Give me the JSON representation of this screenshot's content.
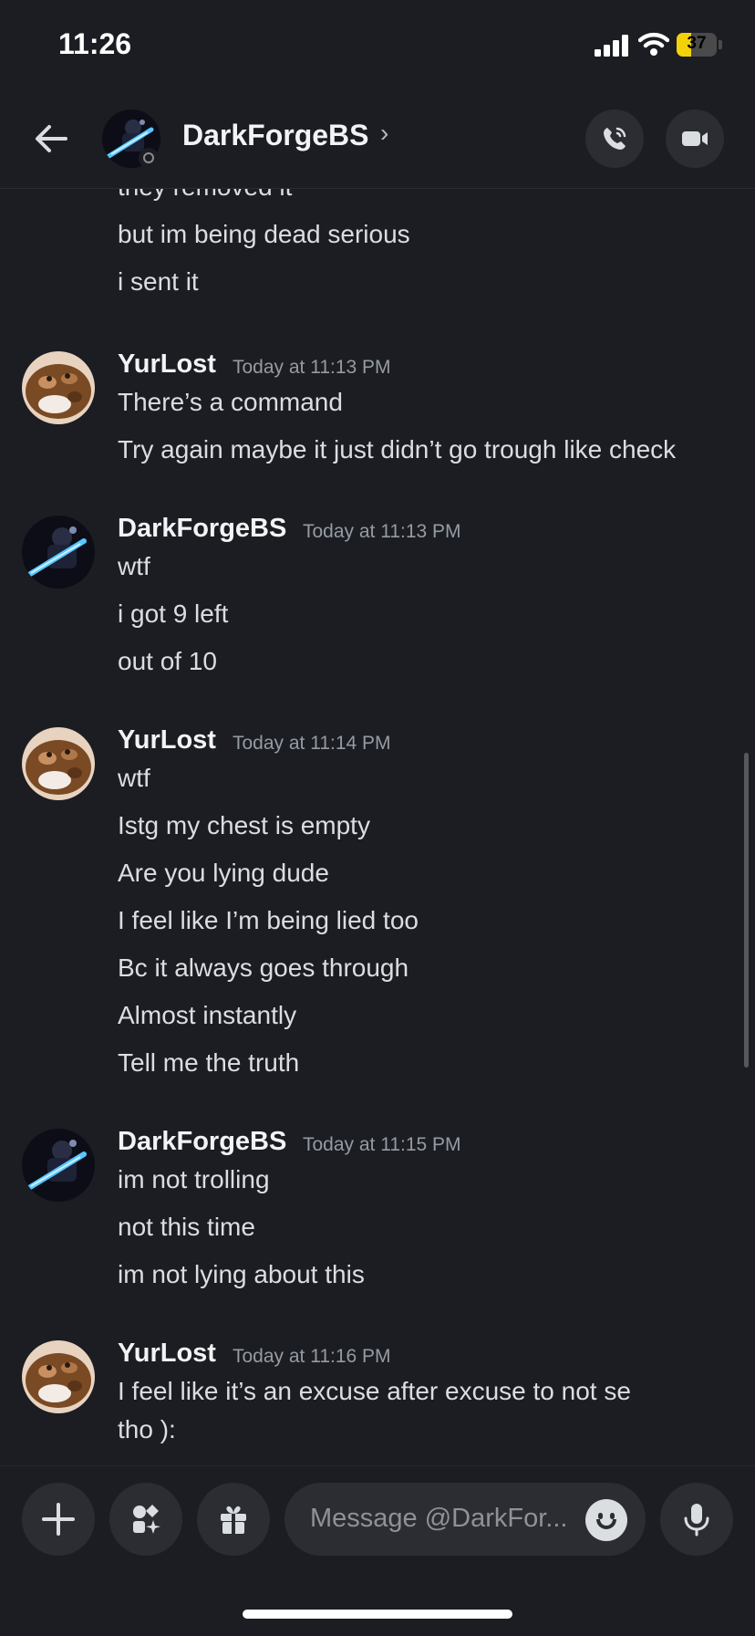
{
  "status_bar": {
    "time": "11:26",
    "battery": "37",
    "battery_level": 0.37
  },
  "header": {
    "name": "DarkForgeBS",
    "chevron": "›",
    "call_icon": "phone-icon",
    "video_icon": "video-camera-icon"
  },
  "messages": {
    "continued": [
      "they removed it",
      "but im being dead serious",
      "i sent it"
    ],
    "groups": [
      {
        "author": "YurLost",
        "timestamp": "Today at 11:13 PM",
        "avatar": "frog-avatar",
        "lines": [
          "There’s a command",
          "Try again maybe it just didn’t go trough like check"
        ]
      },
      {
        "author": "DarkForgeBS",
        "timestamp": "Today at 11:13 PM",
        "avatar": "knight-avatar",
        "lines": [
          "wtf",
          "i got 9 left",
          "out of 10"
        ]
      },
      {
        "author": "YurLost",
        "timestamp": "Today at 11:14 PM",
        "avatar": "frog-avatar",
        "lines": [
          "wtf",
          "Istg my chest is empty",
          "Are you lying dude",
          "I feel like I’m being lied too",
          "Bc it always goes through",
          "Almost instantly",
          "Tell me the truth"
        ]
      },
      {
        "author": "DarkForgeBS",
        "timestamp": "Today at 11:15 PM",
        "avatar": "knight-avatar",
        "lines": [
          "im not trolling",
          "not this time",
          "im not lying about this"
        ]
      },
      {
        "author": "YurLost",
        "timestamp": "Today at 11:16 PM",
        "avatar": "frog-avatar",
        "lines": [
          "I feel like it’s an excuse after excuse to not se",
          "tho ):"
        ]
      }
    ]
  },
  "composer": {
    "placeholder": "Message @DarkFor..."
  },
  "colors": {
    "background": "#1c1d22",
    "button": "#2b2d33",
    "text": "#dbdee1",
    "muted": "#949ba4",
    "battery": "#f4d20a"
  }
}
